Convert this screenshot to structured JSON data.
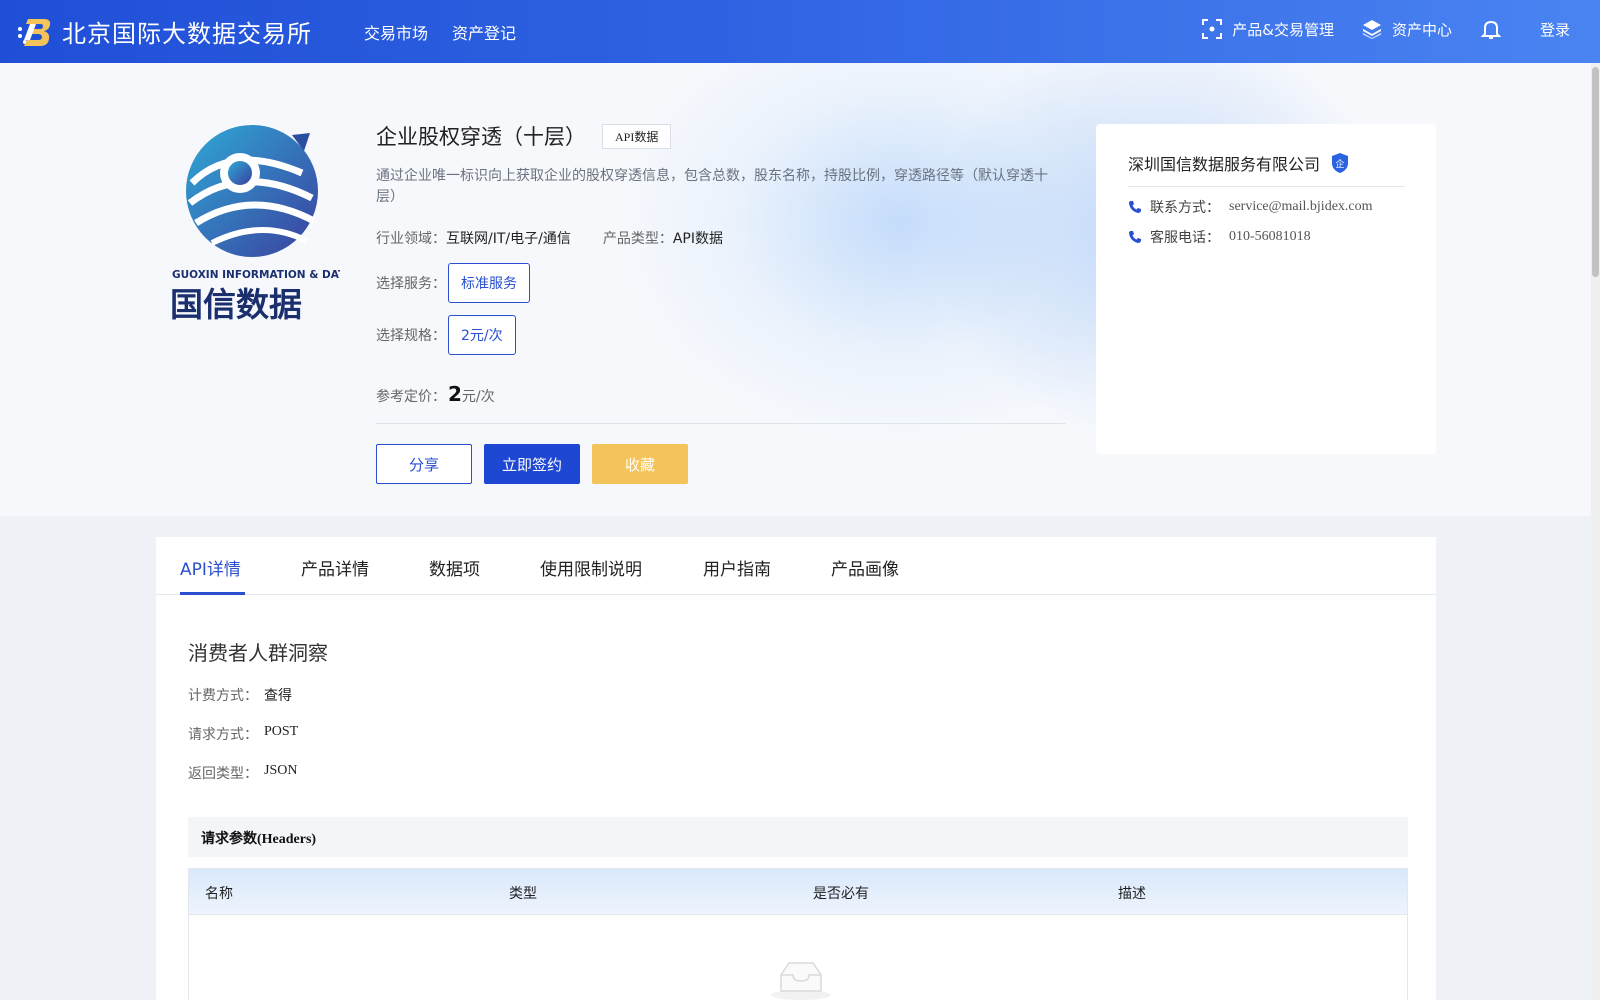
{
  "header": {
    "brand_name": "北京国际大数据交易所",
    "nav_left": [
      "交易市场",
      "资产登记"
    ],
    "product_trade": "产品&交易管理",
    "asset_center": "资产中心",
    "login": "登录"
  },
  "product": {
    "logo_text": "国信数据",
    "logo_subtext": "GUOXIN INFORMATION & DATA",
    "title": "企业股权穿透（十层）",
    "tag": "API数据",
    "description": "通过企业唯一标识向上获取企业的股权穿透信息，包含总数，股东名称，持股比例，穿透路径等（默认穿透十层）",
    "industry_label": "行业领域：",
    "industry_value": "互联网/IT/电子/通信",
    "type_label": "产品类型：",
    "type_value": "API数据",
    "service_label": "选择服务：",
    "service_value": "标准服务",
    "spec_label": "选择规格：",
    "spec_value": "2元/次",
    "price_label": "参考定价：",
    "price_value": "2",
    "price_unit": "元/次",
    "share_label": "分享",
    "sign_label": "立即签约",
    "favorite_label": "收藏"
  },
  "company": {
    "name": "深圳国信数据服务有限公司",
    "badge": "企",
    "contact_label": "联系方式：",
    "contact_value": "service@mail.bjidex.com",
    "phone_label": "客服电话：",
    "phone_value": "010-56081018"
  },
  "tabs": [
    "API详情",
    "产品详情",
    "数据项",
    "使用限制说明",
    "用户指南",
    "产品画像"
  ],
  "api": {
    "section_title": "消费者人群洞察",
    "billing_label": "计费方式：",
    "billing_value": "查得",
    "method_label": "请求方式：",
    "method_value": "POST",
    "return_label": "返回类型：",
    "return_value": "JSON",
    "headers_title": "请求参数(Headers)",
    "columns": [
      "名称",
      "类型",
      "是否必有",
      "描述"
    ]
  },
  "colors": {
    "nav_start": "#1f4fd6",
    "nav_end": "#4a84f2",
    "primary": "#1e47d4",
    "favorite": "#f4c35a"
  }
}
